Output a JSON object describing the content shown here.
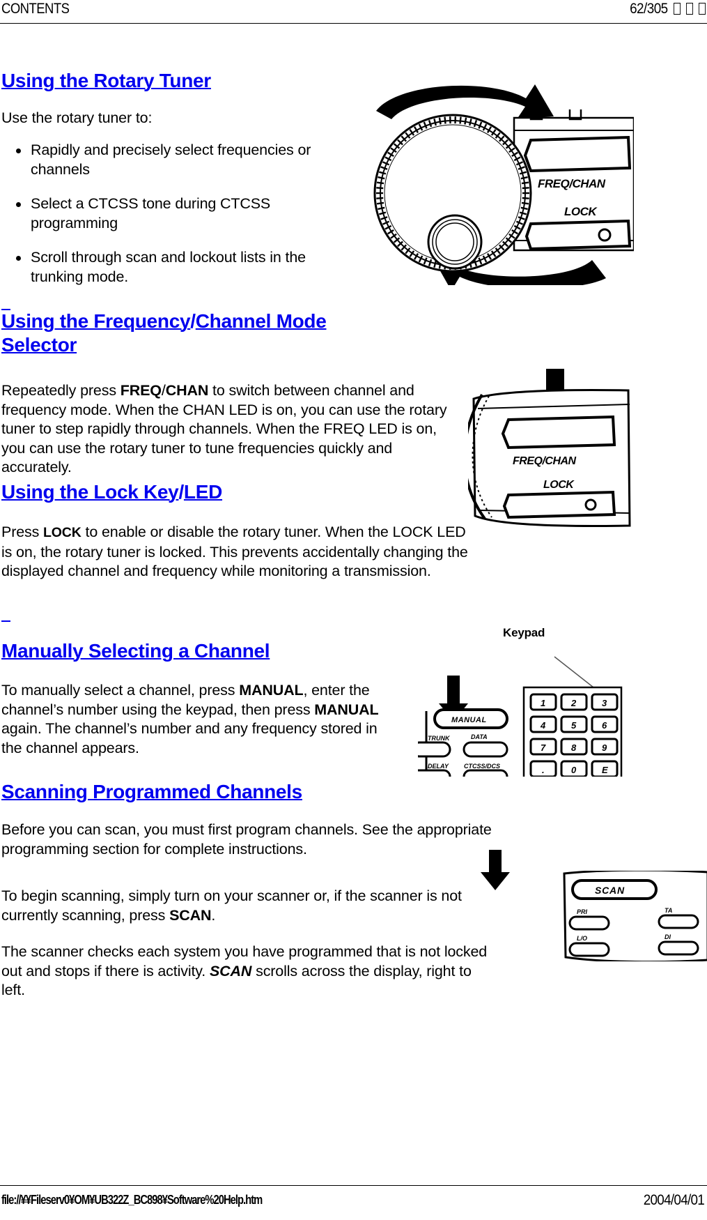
{
  "header": {
    "left_label": "CONTENTS",
    "page_indicator": "62/305",
    "missing_glyphs": [
      "tofu",
      "tofu",
      "tofu"
    ]
  },
  "footer": {
    "file_path": "file://¥¥Fileserv0¥OM¥UB322Z_BC898¥Software%20Help.htm",
    "date": "2004/04/01"
  },
  "sections": {
    "rotary_tuner": {
      "heading": "Using the Rotary Tuner",
      "intro": "Use the rotary tuner to:",
      "bullets": [
        "Rapidly and precisely select frequencies or channels",
        "Select a CTCSS tone during CTCSS programming",
        "Scroll through scan and lockout lists in the trunking mode."
      ]
    },
    "freq_chan_selector": {
      "heading_part1": "Using the Frequency",
      "heading_slash": "/",
      "heading_part2": "Channel Mode Selector",
      "paragraph_pre": "Repeatedly press ",
      "paragraph_bold1": "FREQ",
      "paragraph_slash": "/",
      "paragraph_bold2": "CHAN",
      "paragraph_post": " to switch between channel and frequency mode. When the CHAN LED is on, you can use the rotary tuner to step rapidly through channels. When the FREQ LED is on, you can use the rotary tuner to tune frequencies quickly and accurately."
    },
    "lock_key": {
      "heading_part1": "Using the Lock Key",
      "heading_slash": "/",
      "heading_part2": "LED",
      "paragraph_pre": "Press ",
      "paragraph_bold": "LOCK",
      "paragraph_post": " to enable or disable the rotary tuner. When the LOCK LED is on, the rotary tuner is locked. This prevents accidentally changing the displayed channel and frequency while monitoring a transmission."
    },
    "manual_channel": {
      "heading": "Manually Selecting a Channel",
      "paragraph_pre": "To manually select a channel, press ",
      "paragraph_bold1": "MANUAL",
      "paragraph_mid": ", enter the channel’s number using the keypad, then press ",
      "paragraph_bold2": "MANUAL",
      "paragraph_post": " again. The channel’s number and any frequency stored in the channel appears."
    },
    "scanning": {
      "heading": "Scanning Programmed Channels",
      "paragraph1": "Before you can scan, you must first program channels. See the appropriate programming section for complete instructions.",
      "paragraph2_pre": "To begin scanning, simply turn on your scanner or, if the scanner is not currently scanning, press ",
      "paragraph2_bold": "SCAN",
      "paragraph2_post": ".",
      "paragraph3_pre": "The scanner checks each system you have programmed that is not locked out and stops if there is activity. ",
      "paragraph3_bolditalic": "SCAN",
      "paragraph3_post": " scrolls across the display, right to left."
    }
  },
  "figures": {
    "rotary_tuner_panel": {
      "name": "rotary-tuner-illustration",
      "button_labels": [
        "FREQ/CHAN",
        "LOCK"
      ]
    },
    "freq_chan_panel": {
      "name": "freq-chan-button-illustration",
      "button_labels": [
        "FREQ/CHAN",
        "LOCK"
      ]
    },
    "keypad_panel": {
      "name": "keypad-illustration",
      "callout_label": "Keypad",
      "left_buttons": [
        "MANUAL",
        "TRUNK",
        "DATA",
        "DELAY",
        "CTCSS/DCS"
      ],
      "keypad_keys": [
        [
          "1",
          "2",
          "3"
        ],
        [
          "4",
          "5",
          "6"
        ],
        [
          "7",
          "8",
          "9"
        ],
        [
          ".",
          "0",
          "E"
        ]
      ]
    },
    "scan_panel": {
      "name": "scan-button-illustration",
      "button_labels": [
        "SCAN",
        "PRI",
        "TA",
        "L/O",
        "DI"
      ]
    }
  },
  "colors": {
    "link": "#0000ee",
    "text": "#000000",
    "background": "#ffffff"
  }
}
